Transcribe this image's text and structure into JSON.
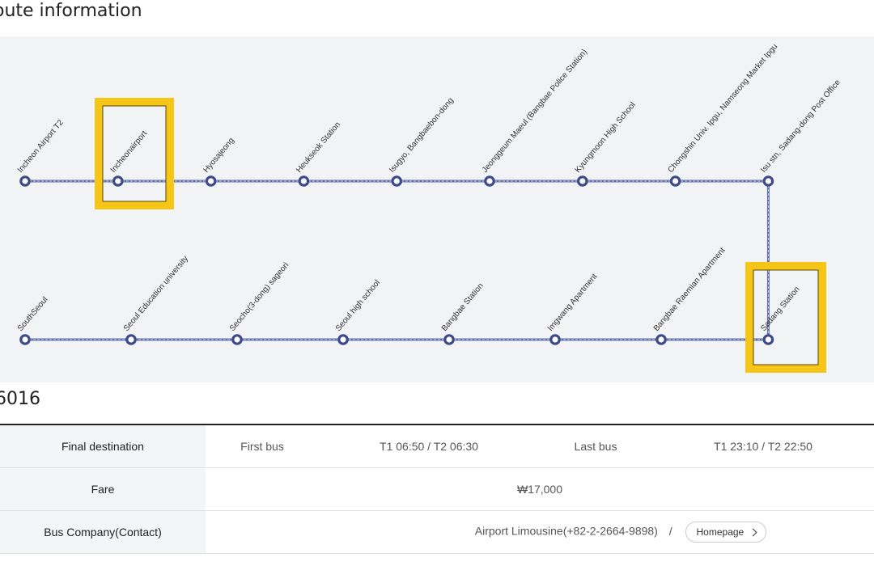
{
  "section_title": "oute information",
  "bus_number": "6016",
  "route": {
    "top_row": [
      "Incheon Airport T2",
      "Incheonairport",
      "Hyosajeong",
      "Heukseok Station",
      "Isugyo, Bangbaebon-dong",
      "Jeonggeum Maeul (Bangbae Police Station)",
      "Kyungmoon High School",
      "Chongshin Univ. Ipgu, Namseong Market Ipgu",
      "Isu stn, Sadang-dong Post Office"
    ],
    "bottom_row": [
      "SouthSeoul",
      "Seoul Education university",
      "Seocho(3-dong) sageori",
      "Seoul high school",
      "Bangbae Station",
      "Imgwang Apartment",
      "Bangbae Raemian Apartment",
      "Sadang Station"
    ],
    "highlight_color": "#f5c518",
    "line_color": "#3d4a8a"
  },
  "table": {
    "final_destination_label": "Final destination",
    "first_bus_label": "First bus",
    "first_bus_value": "T1 06:50 / T2 06:30",
    "last_bus_label": "Last bus",
    "last_bus_value": "T1 23:10 / T2 22:50",
    "fare_label": "Fare",
    "fare_value": "₩17,000",
    "company_label": "Bus Company(Contact)",
    "company_value": "Airport Limousine(+82-2-2664-9898)",
    "separator": "/",
    "homepage_label": "Homepage"
  }
}
